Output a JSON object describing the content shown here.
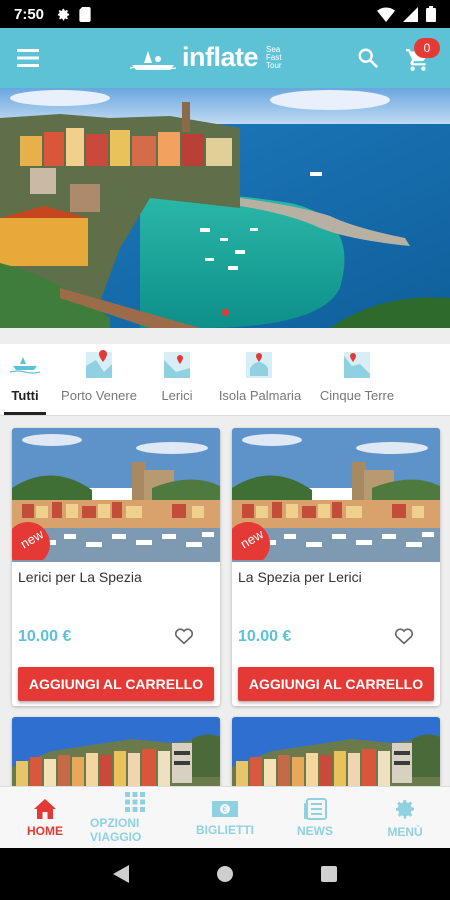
{
  "status_bar": {
    "time": "7:50"
  },
  "app_bar": {
    "logo_text": "inflate",
    "logo_tag_1": "Sea",
    "logo_tag_2": "Fast",
    "logo_tag_3": "Tour",
    "cart_count": "0"
  },
  "colors": {
    "brand": "#5ec2d6",
    "accent": "#e53935"
  },
  "tabs": [
    {
      "label": "Tutti",
      "icon": "boat-icon",
      "active": true
    },
    {
      "label": "Porto Venere",
      "icon": "map-pin-icon"
    },
    {
      "label": "Lerici",
      "icon": "map-pin-icon"
    },
    {
      "label": "Isola Palmaria",
      "icon": "map-pin-icon"
    },
    {
      "label": "Cinque Terre",
      "icon": "map-pin-icon"
    }
  ],
  "products": [
    {
      "badge": "new",
      "title": "Lerici per La Spezia",
      "price": "10.00 €",
      "button": "AGGIUNGI AL CARRELLO"
    },
    {
      "badge": "new",
      "title": "La Spezia per Lerici",
      "price": "10.00 €",
      "button": "AGGIUNGI AL CARRELLO"
    }
  ],
  "bottom_nav": [
    {
      "label": "HOME",
      "icon": "home-icon",
      "active": true
    },
    {
      "label": "OPZIONI VIAGGIO",
      "icon": "grid-icon"
    },
    {
      "label": "BIGLIETTI",
      "icon": "ticket-icon"
    },
    {
      "label": "NEWS",
      "icon": "news-icon"
    },
    {
      "label": "MENÙ",
      "icon": "gear-icon"
    }
  ]
}
